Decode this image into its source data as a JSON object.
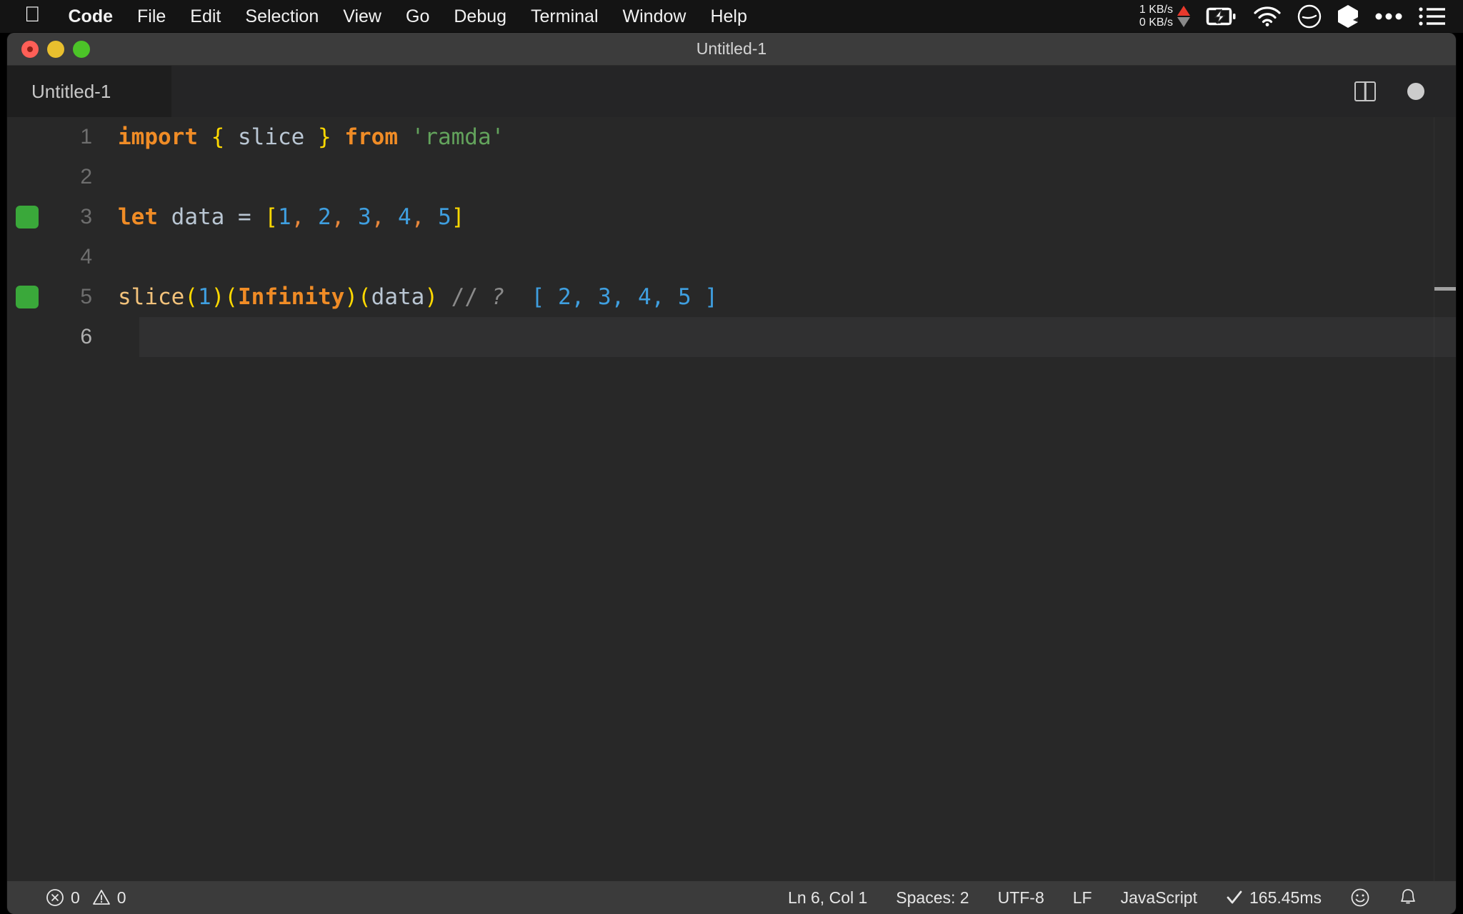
{
  "menubar": {
    "apple_icon": "apple-logo-icon",
    "items": [
      {
        "label": "Code",
        "bold": true
      },
      {
        "label": "File",
        "bold": false
      },
      {
        "label": "Edit",
        "bold": false
      },
      {
        "label": "Selection",
        "bold": false
      },
      {
        "label": "View",
        "bold": false
      },
      {
        "label": "Go",
        "bold": false
      },
      {
        "label": "Debug",
        "bold": false
      },
      {
        "label": "Terminal",
        "bold": false
      },
      {
        "label": "Window",
        "bold": false
      },
      {
        "label": "Help",
        "bold": false
      }
    ],
    "network": {
      "upload": "1 KB/s",
      "download": "0 KB/s",
      "upload_arrow_color": "#e8392c",
      "download_arrow_color": "#8a8a8a"
    },
    "status_icons": [
      "battery-charging-icon",
      "wifi-icon",
      "do-not-disturb-icon",
      "cube-icon",
      "three-dots-icon",
      "list-menu-icon"
    ]
  },
  "window": {
    "title": "Untitled-1",
    "traffic_lights": [
      "close-red",
      "minimize-yellow",
      "maximize-green"
    ]
  },
  "tabs": [
    {
      "label": "Untitled-1",
      "active": true,
      "dirty": true
    }
  ],
  "editor_actions": {
    "split_editor": "split-editor-icon",
    "dirty_indicator": "unsaved-dot-icon"
  },
  "editor": {
    "background": "#282828",
    "active_line": 6,
    "lines": [
      {
        "number": "1",
        "breakpoint": false,
        "tokens": [
          {
            "t": "import",
            "c": "kw"
          },
          {
            "t": " ",
            "c": "op"
          },
          {
            "t": "{",
            "c": "brace"
          },
          {
            "t": " slice ",
            "c": "ident"
          },
          {
            "t": "}",
            "c": "brace"
          },
          {
            "t": " ",
            "c": "op"
          },
          {
            "t": "from",
            "c": "kw"
          },
          {
            "t": " ",
            "c": "op"
          },
          {
            "t": "'ramda'",
            "c": "str"
          }
        ]
      },
      {
        "number": "2",
        "breakpoint": false,
        "tokens": []
      },
      {
        "number": "3",
        "breakpoint": true,
        "tokens": [
          {
            "t": "let",
            "c": "kw"
          },
          {
            "t": " data ",
            "c": "ident"
          },
          {
            "t": "=",
            "c": "op"
          },
          {
            "t": " ",
            "c": "op"
          },
          {
            "t": "[",
            "c": "brace"
          },
          {
            "t": "1",
            "c": "num"
          },
          {
            "t": ",",
            "c": "punct"
          },
          {
            "t": " ",
            "c": "op"
          },
          {
            "t": "2",
            "c": "num"
          },
          {
            "t": ",",
            "c": "punct"
          },
          {
            "t": " ",
            "c": "op"
          },
          {
            "t": "3",
            "c": "num"
          },
          {
            "t": ",",
            "c": "punct"
          },
          {
            "t": " ",
            "c": "op"
          },
          {
            "t": "4",
            "c": "num"
          },
          {
            "t": ",",
            "c": "punct"
          },
          {
            "t": " ",
            "c": "op"
          },
          {
            "t": "5",
            "c": "num"
          },
          {
            "t": "]",
            "c": "brace"
          }
        ]
      },
      {
        "number": "4",
        "breakpoint": false,
        "tokens": []
      },
      {
        "number": "5",
        "breakpoint": true,
        "tokens": [
          {
            "t": "slice",
            "c": "fn"
          },
          {
            "t": "(",
            "c": "brace"
          },
          {
            "t": "1",
            "c": "num"
          },
          {
            "t": ")",
            "c": "brace"
          },
          {
            "t": "(",
            "c": "brace"
          },
          {
            "t": "Infinity",
            "c": "kw"
          },
          {
            "t": ")",
            "c": "brace"
          },
          {
            "t": "(",
            "c": "brace"
          },
          {
            "t": "data",
            "c": "ident"
          },
          {
            "t": ")",
            "c": "brace"
          },
          {
            "t": " ",
            "c": "op"
          },
          {
            "t": "//",
            "c": "comment"
          },
          {
            "t": " ",
            "c": "op"
          },
          {
            "t": "?",
            "c": "comment-q"
          },
          {
            "t": "  ",
            "c": "op"
          },
          {
            "t": "[ 2, 3, 4, 5 ]",
            "c": "result"
          }
        ]
      },
      {
        "number": "6",
        "breakpoint": false,
        "tokens": []
      }
    ]
  },
  "statusbar": {
    "errors_icon": "error-circle-icon",
    "errors_count": "0",
    "warnings_icon": "warning-triangle-icon",
    "warnings_count": "0",
    "cursor_position": "Ln 6, Col 1",
    "indentation": "Spaces: 2",
    "encoding": "UTF-8",
    "eol": "LF",
    "language": "JavaScript",
    "run_status_icon": "checkmark-icon",
    "run_time": "165.45ms",
    "feedback_icon": "smiley-icon",
    "notifications_icon": "bell-icon"
  }
}
